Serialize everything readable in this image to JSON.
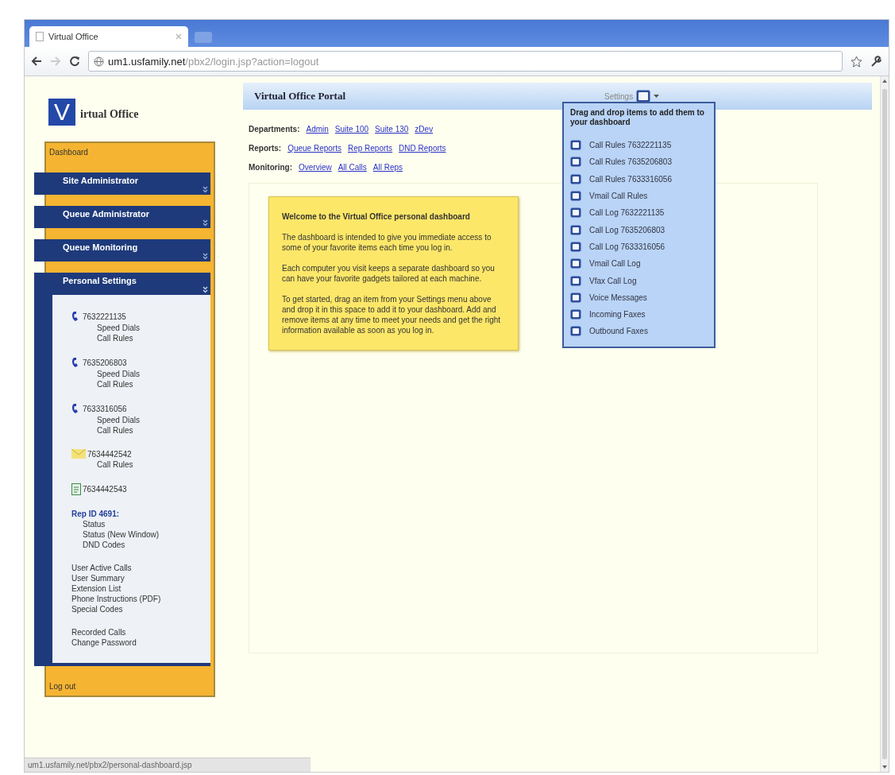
{
  "browser": {
    "tab_title": "Virtual Office",
    "url_host": "um1.usfamily.net",
    "url_path": "/pbx2/login.jsp?action=logout",
    "status_text": "um1.usfamily.net/pbx2/personal-dashboard.jsp"
  },
  "sidebar": {
    "logo_letter": "V",
    "logo_text": "irtual Office",
    "top_link": "Dashboard",
    "bottom_link": "Log out",
    "sections": [
      {
        "title": "Site Administrator",
        "expanded": false
      },
      {
        "title": "Queue Administrator",
        "expanded": false
      },
      {
        "title": "Queue Monitoring",
        "expanded": false
      },
      {
        "title": "Personal Settings",
        "expanded": true,
        "groups": [
          {
            "kind": "phone",
            "title": "7632221135",
            "links": [
              "Speed Dials",
              "Call Rules"
            ]
          },
          {
            "kind": "phone",
            "title": "7635206803",
            "links": [
              "Speed Dials",
              "Call Rules"
            ]
          },
          {
            "kind": "phone",
            "title": "7633316056",
            "links": [
              "Speed Dials",
              "Call Rules"
            ]
          },
          {
            "kind": "voicemail",
            "title": "7634442542",
            "links": [
              "Call Rules"
            ]
          },
          {
            "kind": "fax",
            "title": "7634442543"
          },
          {
            "kind": "rep",
            "title": "Rep ID 4691:",
            "links": [
              "Status",
              "Status (New Window)",
              "DND Codes"
            ]
          },
          {
            "kind": "list",
            "links": [
              "User Active Calls",
              "User Summary",
              "Extension List",
              "Phone Instructions (PDF)",
              "Special Codes"
            ]
          },
          {
            "kind": "list",
            "links": [
              "Recorded Calls",
              "Change Password"
            ]
          }
        ]
      }
    ]
  },
  "main": {
    "title": "Virtual Office Portal",
    "settings_label": "Settings",
    "link_rows": [
      {
        "label": "Departments:",
        "links": [
          "Admin",
          "Suite 100",
          "Suite 130",
          "zDev"
        ]
      },
      {
        "label": "Reports:",
        "links": [
          "Queue Reports",
          "Rep Reports",
          "DND Reports"
        ]
      },
      {
        "label": "Monitoring:",
        "links": [
          "Overview",
          "All Calls",
          "All Reps"
        ]
      }
    ],
    "welcome": {
      "heading": "Welcome to the Virtual Office personal dashboard",
      "paragraphs": [
        "The dashboard is intended to give you immediate access to some of your favorite items each time you log in.",
        "Each computer you visit keeps a separate dashboard so you can have your favorite gadgets tailored at each machine.",
        "To get started, drag an item from your Settings menu above and drop it in this space to add it to your dashboard. Add and remove items at any time to meet your needs and get the right information available as soon as you log in."
      ]
    }
  },
  "settings_menu": {
    "heading": "Drag and drop items to add them to your dashboard",
    "items": [
      "Call Rules 7632221135",
      "Call Rules 7635206803",
      "Call Rules 7633316056",
      "Vmail Call Rules",
      "Call Log 7632221135",
      "Call Log 7635206803",
      "Call Log 7633316056",
      "Vmail Call Log",
      "Vfax Call Log",
      "Voice Messages",
      "Incoming Faxes",
      "Outbound Faxes"
    ]
  }
}
